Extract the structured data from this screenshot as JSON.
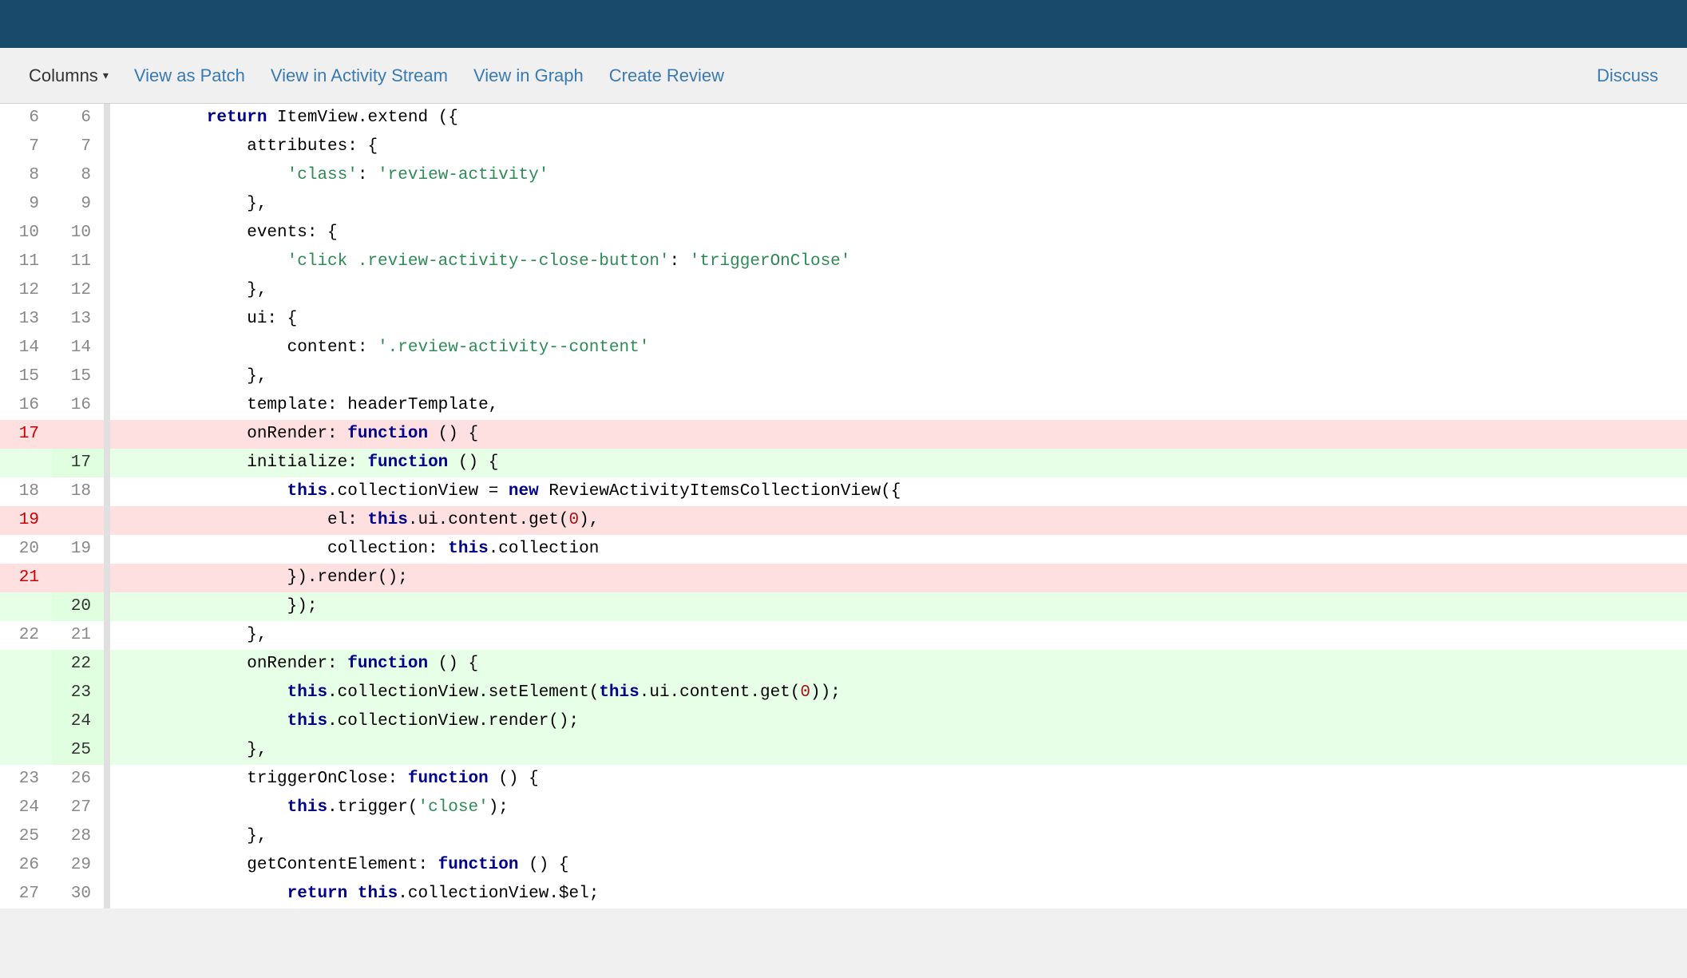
{
  "topbar": {
    "background": "#1a4a6b"
  },
  "toolbar": {
    "columns_label": "Columns",
    "view_as_patch_label": "View as Patch",
    "view_in_activity_stream_label": "View in Activity Stream",
    "view_in_graph_label": "View in Graph",
    "create_review_label": "Create Review",
    "discuss_label": "Discuss"
  },
  "code": {
    "lines": [
      {
        "ln_old": "6",
        "ln_new": "6",
        "type": "normal",
        "content": "        return ItemView.extend ({"
      },
      {
        "ln_old": "7",
        "ln_new": "7",
        "type": "normal",
        "content": "            attributes: {"
      },
      {
        "ln_old": "8",
        "ln_new": "8",
        "type": "normal",
        "content": "                'class': 'review-activity'"
      },
      {
        "ln_old": "9",
        "ln_new": "9",
        "type": "normal",
        "content": "            },"
      },
      {
        "ln_old": "10",
        "ln_new": "10",
        "type": "normal",
        "content": "            events: {"
      },
      {
        "ln_old": "11",
        "ln_new": "11",
        "type": "normal",
        "content": "                'click .review-activity--close-button': 'triggerOnClose'"
      },
      {
        "ln_old": "12",
        "ln_new": "12",
        "type": "normal",
        "content": "            },"
      },
      {
        "ln_old": "13",
        "ln_new": "13",
        "type": "normal",
        "content": "            ui: {"
      },
      {
        "ln_old": "14",
        "ln_new": "14",
        "type": "normal",
        "content": "                content: '.review-activity--content'"
      },
      {
        "ln_old": "15",
        "ln_new": "15",
        "type": "normal",
        "content": "            },"
      },
      {
        "ln_old": "16",
        "ln_new": "16",
        "type": "normal",
        "content": "            template: headerTemplate,"
      },
      {
        "ln_old": "17",
        "ln_new": "",
        "type": "deleted",
        "content": "            onRender: function () {"
      },
      {
        "ln_old": "",
        "ln_new": "17",
        "type": "added",
        "content": "            initialize: function () {"
      },
      {
        "ln_old": "18",
        "ln_new": "18",
        "type": "normal",
        "content": "                this.collectionView = new ReviewActivityItemsCollectionView({"
      },
      {
        "ln_old": "19",
        "ln_new": "",
        "type": "deleted",
        "content": "                    el: this.ui.content.get(0),"
      },
      {
        "ln_old": "20",
        "ln_new": "19",
        "type": "normal",
        "content": "                    collection: this.collection"
      },
      {
        "ln_old": "21",
        "ln_new": "",
        "type": "deleted",
        "content": "                }).render();"
      },
      {
        "ln_old": "",
        "ln_new": "20",
        "type": "added",
        "content": "                });"
      },
      {
        "ln_old": "22",
        "ln_new": "21",
        "type": "normal",
        "content": "            },"
      },
      {
        "ln_old": "",
        "ln_new": "22",
        "type": "added",
        "content": "            onRender: function () {"
      },
      {
        "ln_old": "",
        "ln_new": "23",
        "type": "added",
        "content": "                this.collectionView.setElement(this.ui.content.get(0));"
      },
      {
        "ln_old": "",
        "ln_new": "24",
        "type": "added",
        "content": "                this.collectionView.render();"
      },
      {
        "ln_old": "",
        "ln_new": "25",
        "type": "added",
        "content": "            },"
      },
      {
        "ln_old": "23",
        "ln_new": "26",
        "type": "normal",
        "content": "            triggerOnClose: function () {"
      },
      {
        "ln_old": "24",
        "ln_new": "27",
        "type": "normal",
        "content": "                this.trigger('close');"
      },
      {
        "ln_old": "25",
        "ln_new": "28",
        "type": "normal",
        "content": "            },"
      },
      {
        "ln_old": "26",
        "ln_new": "29",
        "type": "normal",
        "content": "            getContentElement: function () {"
      },
      {
        "ln_old": "27",
        "ln_new": "30",
        "type": "normal",
        "content": "                return this.collectionView.$el;"
      }
    ]
  }
}
